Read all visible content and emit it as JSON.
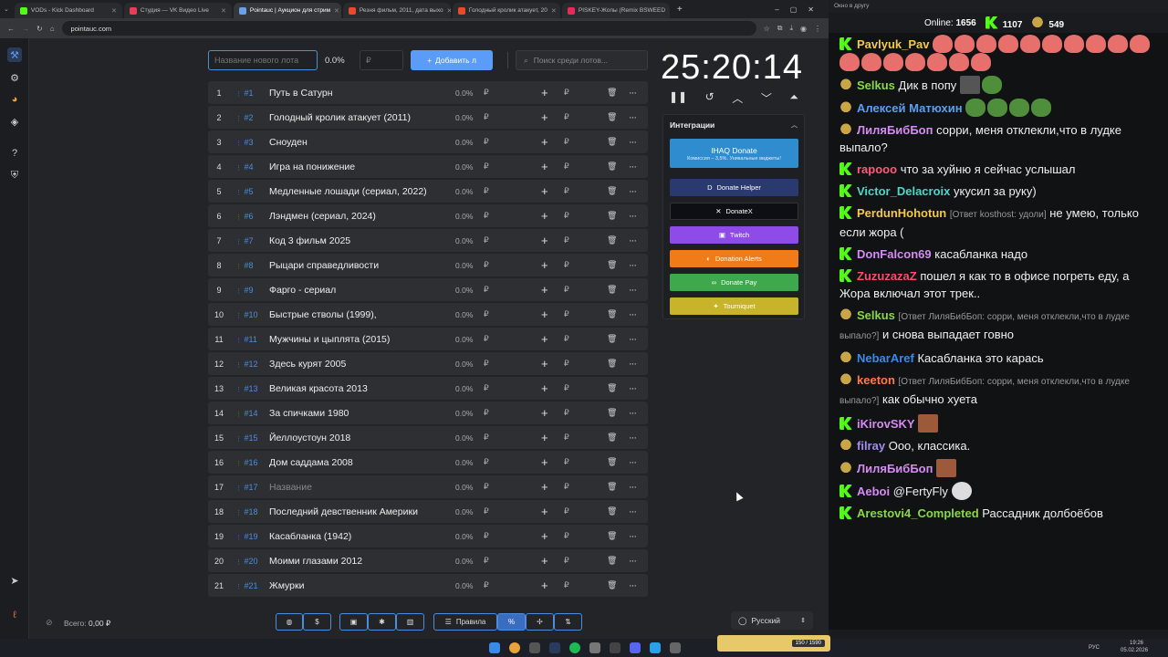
{
  "browser": {
    "tabs": [
      {
        "label": "VODs - Kick Dashboard",
        "color": "#53fc18"
      },
      {
        "label": "Студия — VK Видео Live",
        "color": "#e83e5a"
      },
      {
        "label": "Pointauc | Аукцион для стрим",
        "color": "#6aa0e8"
      },
      {
        "label": "Резня фильм, 2011, дата выхо",
        "color": "#e84a2a"
      },
      {
        "label": "Голодный кролик атакует, 20",
        "color": "#e84a2a"
      },
      {
        "label": "PISKEY-Жопы (Remix BSWEED",
        "color": "#e82a5a"
      }
    ],
    "url": "pointauc.com"
  },
  "lot_form": {
    "name_placeholder": "Название нового лота",
    "percent": "0.0%",
    "sum_placeholder": "₽",
    "add_button": "Добавить л",
    "search_placeholder": "Поиск среди лотов..."
  },
  "lots": [
    {
      "n": "1",
      "id": "#1",
      "name": "Путь в Сатурн"
    },
    {
      "n": "2",
      "id": "#2",
      "name": "Голодный кролик атакует (2011)"
    },
    {
      "n": "3",
      "id": "#3",
      "name": "Сноуден"
    },
    {
      "n": "4",
      "id": "#4",
      "name": "Игра на понижение"
    },
    {
      "n": "5",
      "id": "#5",
      "name": "Медленные лошади (сериал, 2022)"
    },
    {
      "n": "6",
      "id": "#6",
      "name": "Лэндмен (сериал, 2024)"
    },
    {
      "n": "7",
      "id": "#7",
      "name": "Код 3 фильм 2025"
    },
    {
      "n": "8",
      "id": "#8",
      "name": "Рыцари справедливости"
    },
    {
      "n": "9",
      "id": "#9",
      "name": "Фарго - сериал"
    },
    {
      "n": "10",
      "id": "#10",
      "name": "Быстрые стволы (1999),"
    },
    {
      "n": "11",
      "id": "#11",
      "name": "Мужчины и цыплята (2015)"
    },
    {
      "n": "12",
      "id": "#12",
      "name": "Здесь курят 2005"
    },
    {
      "n": "13",
      "id": "#13",
      "name": "Великая красота 2013"
    },
    {
      "n": "14",
      "id": "#14",
      "name": "За спичками 1980"
    },
    {
      "n": "15",
      "id": "#15",
      "name": "Йеллоустоун 2018"
    },
    {
      "n": "16",
      "id": "#16",
      "name": "Дом саддама 2008"
    },
    {
      "n": "17",
      "id": "#17",
      "name": "Название",
      "placeholder": true
    },
    {
      "n": "18",
      "id": "#18",
      "name": "Последний девственник Америки"
    },
    {
      "n": "19",
      "id": "#19",
      "name": "Касабланка (1942)"
    },
    {
      "n": "20",
      "id": "#20",
      "name": "Моими глазами 2012"
    },
    {
      "n": "21",
      "id": "#21",
      "name": "Жмурки"
    }
  ],
  "lot_percent": "0.0%",
  "currency": "₽",
  "timer": "25:20:14",
  "integrations": {
    "title": "Интеграции",
    "ihaq": {
      "label": "IHAQ Donate",
      "sub": "Комиссия – 3,5%. Уникальные виджеты!"
    },
    "buttons": [
      {
        "label": "Donate Helper",
        "color": "#2b3a6e"
      },
      {
        "label": "DonateX",
        "color": "#0e0f14"
      },
      {
        "label": "Twitch",
        "color": "#8e4be8"
      },
      {
        "label": "Donation Alerts",
        "color": "#f07b17"
      },
      {
        "label": "Donate Pay",
        "color": "#3da84c"
      },
      {
        "label": "Tourniquet",
        "color": "#c8b42a"
      }
    ]
  },
  "footer": {
    "total_label": "Всего:",
    "total_value": "0,00 ₽",
    "rules_label": "Правила",
    "language": "Русский"
  },
  "chat": {
    "window_title": "Окно в другу",
    "online_label": "Online:",
    "online_count": "1656",
    "kick_count": "1107",
    "other_count": "549",
    "messages": [
      {
        "badge": "kick",
        "user": "Pavlyuk_Pav",
        "color": "#f2c94c",
        "reply": "",
        "text": "",
        "emotes": [
          "red",
          "red",
          "red",
          "red",
          "red",
          "red",
          "red",
          "red",
          "red",
          "red",
          "red",
          "red",
          "red",
          "red",
          "red",
          "red",
          "red"
        ]
      },
      {
        "badge": "coin",
        "user": "Selkus",
        "color": "#8bd64a",
        "reply": "",
        "text": "Дик в попу",
        "emotes": [
          "green-pre",
          "grey"
        ]
      },
      {
        "badge": "coin",
        "user": "Алексей Матюхин",
        "color": "#5aa0f2",
        "reply": "",
        "text": "",
        "emotes": [
          "green",
          "green",
          "green",
          "green"
        ]
      },
      {
        "badge": "coin",
        "user": "ЛиляБибБоп",
        "color": "#d58cf2",
        "reply": "",
        "text": "сорри, меня отклекли,что в лудке выпало?",
        "emotes": []
      },
      {
        "badge": "kick",
        "user": "rapooo",
        "color": "#ff5a7a",
        "reply": "",
        "text": "что за хуйню я сейчас услышал",
        "emotes": []
      },
      {
        "badge": "kick",
        "user": "Victor_Delacroix",
        "color": "#4fd6c9",
        "reply": "",
        "text": "укусил за руку)",
        "emotes": []
      },
      {
        "badge": "kick",
        "user": "PerdunHohotun",
        "color": "#f2c94c",
        "reply": "[Ответ kosthost: удоли]",
        "text": "не умею, только если жора (",
        "emotes": []
      },
      {
        "badge": "kick",
        "user": "DonFalcon69",
        "color": "#d58cf2",
        "reply": "",
        "text": "касабланка надо",
        "emotes": []
      },
      {
        "badge": "kick",
        "user": "ZuzuzazaZ",
        "color": "#ff4a6a",
        "reply": "",
        "text": "пошел я как то в офисе погреть еду, а Жора включал этот трек..",
        "emotes": []
      },
      {
        "badge": "coin",
        "user": "Selkus",
        "color": "#8bd64a",
        "reply": "[Ответ ЛиляБибБоп: сорри, меня отклекли,что в лудке выпало?]",
        "text": "и снова выпадает говно",
        "emotes": []
      },
      {
        "badge": "coin",
        "user": "NebarAref",
        "color": "#3a8ae8",
        "reply": "",
        "text": "Касабланка это карась",
        "emotes": []
      },
      {
        "badge": "coin",
        "user": "keeton",
        "color": "#ff7a4a",
        "reply": "[Ответ ЛиляБибБоп: сорри, меня отклекли,что в лудке выпало?]",
        "text": "как обычно хуета",
        "emotes": []
      },
      {
        "badge": "kick",
        "user": "iKirovSKY",
        "color": "#d58cf2",
        "reply": "",
        "text": "",
        "emotes": [
          "brown"
        ]
      },
      {
        "badge": "coin",
        "user": "filray",
        "color": "#a58cf2",
        "reply": "",
        "text": "Ооо, классика.",
        "emotes": []
      },
      {
        "badge": "coin",
        "user": "ЛиляБибБоп",
        "color": "#d58cf2",
        "reply": "",
        "text": "",
        "emotes": [
          "brown"
        ]
      },
      {
        "badge": "kick",
        "user": "Aeboi",
        "color": "#d58cf2",
        "reply": "",
        "text": "@FertyFly",
        "emotes": [
          "white"
        ]
      },
      {
        "badge": "kick",
        "user": "Arestovi4_Completed",
        "color": "#8bd64a",
        "reply": "",
        "text": "Рассадник долбоёбов",
        "emotes": []
      }
    ]
  },
  "taskbar": {
    "lang": "РУС",
    "time": "19:26",
    "date": "05.02.2026",
    "widget": "150 / 1590"
  }
}
